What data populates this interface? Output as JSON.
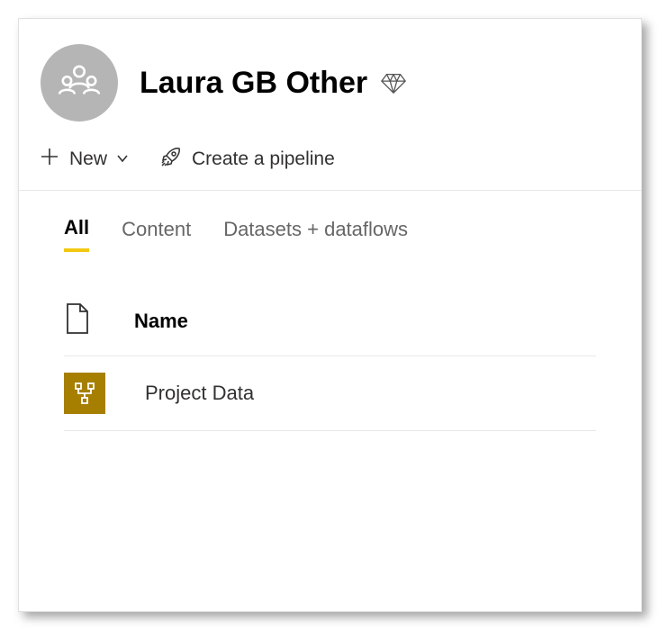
{
  "header": {
    "title": "Laura GB Other"
  },
  "toolbar": {
    "new_label": "New",
    "pipeline_label": "Create a pipeline"
  },
  "tabs": [
    {
      "label": "All",
      "active": true
    },
    {
      "label": "Content",
      "active": false
    },
    {
      "label": "Datasets + dataflows",
      "active": false
    }
  ],
  "table": {
    "header_name": "Name",
    "rows": [
      {
        "name": "Project Data",
        "type": "dataflow"
      }
    ]
  }
}
